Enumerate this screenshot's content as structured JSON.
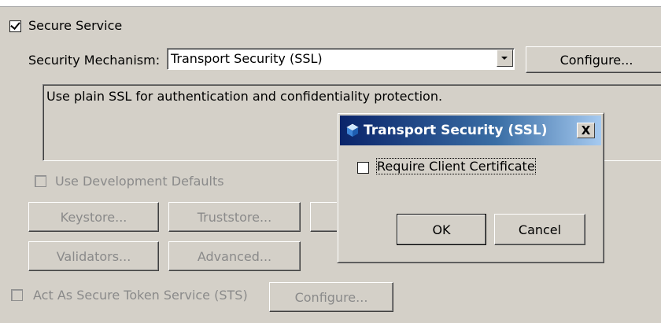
{
  "secure_service": {
    "label": "Secure Service",
    "checked": true
  },
  "security_mechanism": {
    "label": "Security Mechanism:",
    "value": "Transport Security (SSL)",
    "configure_label": "Configure..."
  },
  "description": "Use plain SSL for authentication and confidentiality protection.",
  "dev_defaults": {
    "label": "Use Development Defaults",
    "checked": false
  },
  "buttons": {
    "keystore": "Keystore...",
    "truststore": "Truststore...",
    "validators": "Validators...",
    "advanced": "Advanced..."
  },
  "sts": {
    "label": "Act As Secure Token Service (STS)",
    "configure_label": "Configure..."
  },
  "dialog": {
    "title": "Transport Security (SSL)",
    "close_glyph": "X",
    "require_client_cert": {
      "label": "Require Client Certificate",
      "checked": false
    },
    "ok_label": "OK",
    "cancel_label": "Cancel"
  },
  "colors": {
    "panel": "#d4d0c8",
    "titlebar_start": "#0a246a",
    "titlebar_end": "#a6caf0",
    "disabled_text": "#8a8a8a"
  },
  "icons": {
    "title": "cube-icon",
    "dropdown": "chevron-down-icon",
    "close": "close-icon"
  }
}
